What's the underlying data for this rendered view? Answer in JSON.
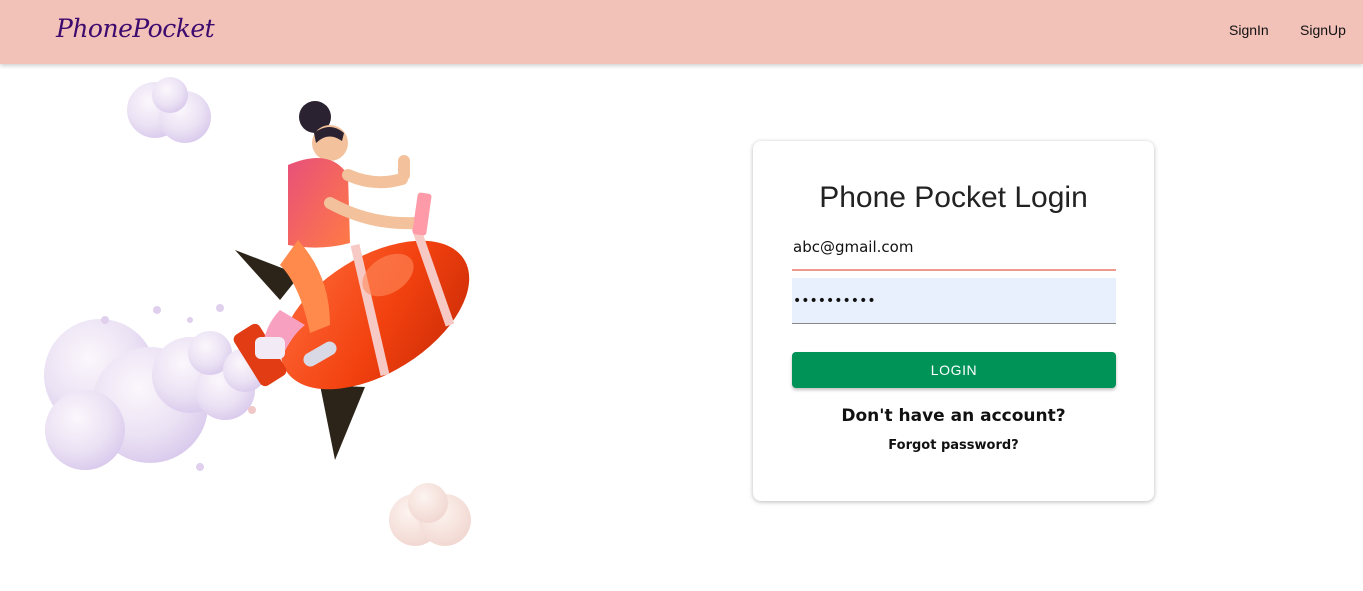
{
  "header": {
    "logo": "PhonePocket",
    "nav": {
      "signin": "SignIn",
      "signup": "SignUp"
    }
  },
  "login_card": {
    "title": "Phone Pocket Login",
    "email_value": "abc@gmail.com",
    "password_value": "••••••••••",
    "login_label": "LOGIN",
    "no_account_text": "Don't have an account?",
    "forgot_text": "Forgot password?"
  },
  "illustration": {
    "icon": "rocket-rider-illustration"
  },
  "colors": {
    "navbar_bg": "#f2c1b8",
    "logo": "#3d0a6e",
    "login_button": "#009358",
    "email_underline": "#ef9a8e",
    "password_autofill_bg": "#e8f0fe"
  }
}
